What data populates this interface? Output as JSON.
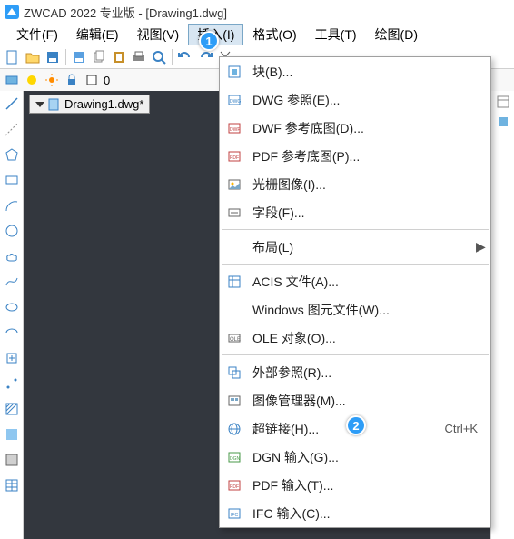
{
  "title": "ZWCAD 2022 专业版 - [Drawing1.dwg]",
  "menubar": {
    "file": "文件(F)",
    "edit": "编辑(E)",
    "view": "视图(V)",
    "insert": "插入(I)",
    "format": "格式(O)",
    "tool": "工具(T)",
    "draw": "绘图(D)"
  },
  "subbar": {
    "zero": "0"
  },
  "doc_tab": "Drawing1.dwg*",
  "dropdown": {
    "block": "块(B)...",
    "dwg_ref": "DWG 参照(E)...",
    "dwf_under": "DWF 参考底图(D)...",
    "pdf_under": "PDF 参考底图(P)...",
    "raster": "光栅图像(I)...",
    "field": "字段(F)...",
    "layout": "布局(L)",
    "acis": "ACIS 文件(A)...",
    "wmf": "Windows 图元文件(W)...",
    "ole": "OLE 对象(O)...",
    "xref": "外部参照(R)...",
    "imgmgr": "图像管理器(M)...",
    "hyperlink": "超链接(H)...",
    "hyperlink_short": "Ctrl+K",
    "dgn": "DGN 输入(G)...",
    "pdf_in": "PDF 输入(T)...",
    "ifc": "IFC 输入(C)..."
  },
  "callouts": {
    "c1": "1",
    "c2": "2"
  }
}
